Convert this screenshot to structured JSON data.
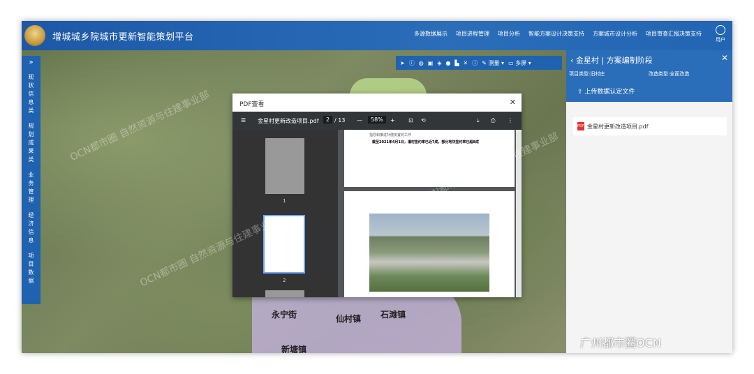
{
  "header": {
    "title": "增城城乡院城市更新智能策划平台",
    "nav": [
      "多源数据展示",
      "项目进程管理",
      "项目分析",
      "智能方案设计决策支持",
      "方案城市设计分析",
      "项目审查汇报决策支持"
    ],
    "user_label": "用户"
  },
  "sidebar": {
    "expand": "»",
    "groups": [
      "现状信息类",
      "规划成果类",
      "业务管理",
      "经济信息",
      "项目数据"
    ]
  },
  "toolbar": {
    "measure": "测量",
    "multiscreen": "多屏"
  },
  "map": {
    "places": [
      "永宁街",
      "仙村镇",
      "石滩镇",
      "新塘镇"
    ]
  },
  "right_panel": {
    "title": "金星村 | 方案编制阶段",
    "project_type": "项目类型:旧村庄",
    "renovation_type": "改造类型:全面改造",
    "upload": "上传数据认定文件",
    "file_name": "金星村更新改造项目.pdf"
  },
  "pdf_viewer": {
    "title": "PDF查看",
    "file_name": "金星村更新改造项目.pdf",
    "current_page": "2",
    "total_pages": "/ 13",
    "zoom": "58%",
    "thumbs": [
      "1",
      "2"
    ],
    "page_text_small": "指导和推进补偿安置的工作",
    "page_text": "截至2021年4月1日，灌村签约率已近7成，部分地块签约率已超8成"
  },
  "watermark": "OCN都市圈 自然资源与住建事业部",
  "wechat_tag": "广州都市圈OCN",
  "colors": {
    "primary": "#1f62b0",
    "header": "#2a6db9"
  }
}
